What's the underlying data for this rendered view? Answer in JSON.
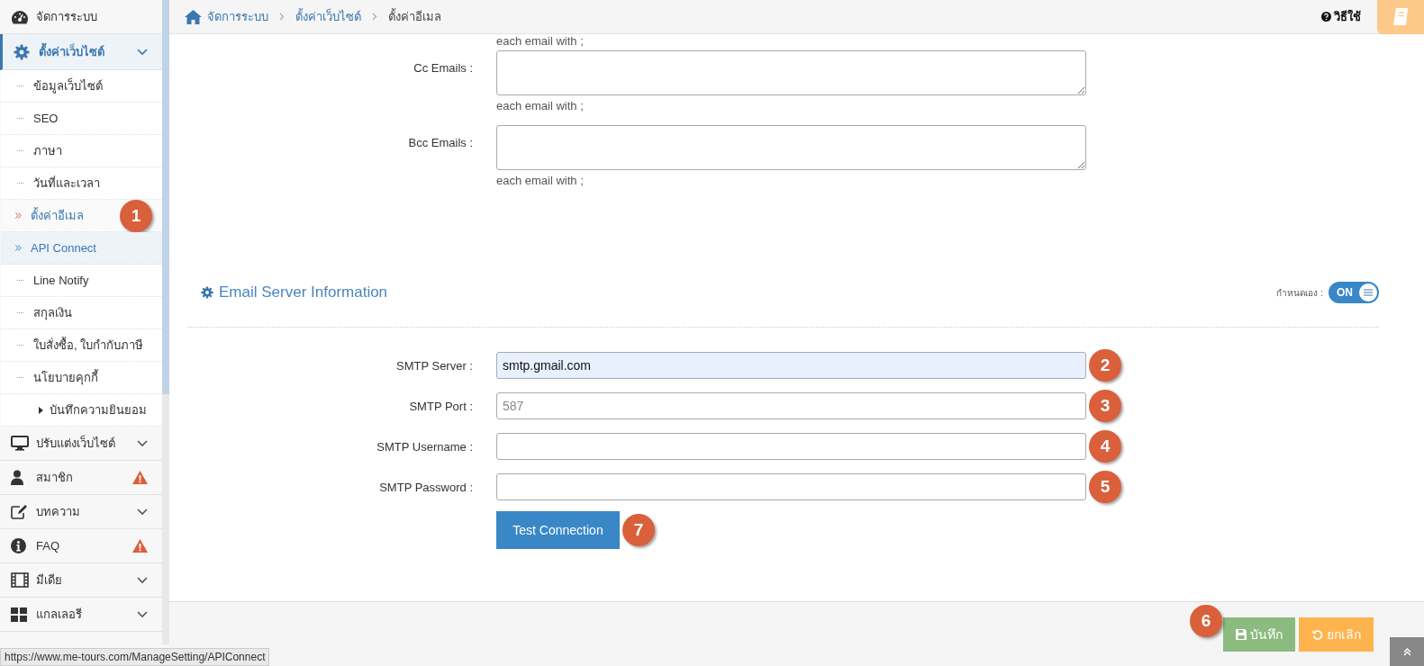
{
  "breadcrumb": [
    {
      "label": "จัดการระบบ",
      "current": false
    },
    {
      "label": "ตั้งค่าเว็บไซต์",
      "current": false
    },
    {
      "label": "ตั้งค่าอีเมล",
      "current": true
    }
  ],
  "help_link": "วิธีใช้",
  "sidebar": {
    "items": [
      {
        "label": "จัดการระบบ",
        "active": false
      },
      {
        "label": "ตั้งค่าเว็บไซต์",
        "active": true,
        "expandable": true,
        "expanded": true,
        "children": [
          {
            "label": "ข้อมูลเว็บไซต์",
            "selected": false,
            "hovered": false
          },
          {
            "label": "SEO",
            "selected": false,
            "hovered": false
          },
          {
            "label": "ภาษา",
            "selected": false,
            "hovered": false
          },
          {
            "label": "วันที่และเวลา",
            "selected": false,
            "hovered": false
          },
          {
            "label": "ตั้งค่าอีเมล",
            "selected": true,
            "hovered": false,
            "callout": "1"
          },
          {
            "label": "API Connect",
            "selected": false,
            "hovered": true
          },
          {
            "label": "Line Notify",
            "selected": false,
            "hovered": false
          },
          {
            "label": "สกุลเงิน",
            "selected": false,
            "hovered": false
          },
          {
            "label": "ใบสั่งซื้อ, ใบกำกับภาษี",
            "selected": false,
            "hovered": false
          },
          {
            "label": "นโยบายคุกกี้",
            "selected": false,
            "hovered": false,
            "children": [
              {
                "label": "บันทึกความยินยอม",
                "selected": false,
                "hovered": false
              }
            ]
          }
        ]
      },
      {
        "label": "ปรับแต่งเว็บไซต์",
        "active": false,
        "expandable": true,
        "expanded": false
      },
      {
        "label": "สมาชิก",
        "active": false,
        "warning": true
      },
      {
        "label": "บทความ",
        "active": false,
        "expandable": true,
        "expanded": false
      },
      {
        "label": "FAQ",
        "active": false,
        "warning": true
      },
      {
        "label": "มีเดีย",
        "active": false,
        "expandable": true,
        "expanded": false
      },
      {
        "label": "แกลเลอรี",
        "active": false,
        "expandable": true,
        "expanded": false
      }
    ]
  },
  "form": {
    "top_hint": "each email with ;",
    "email_fields": [
      {
        "label": "Cc Emails :",
        "hint": "each email with ;"
      },
      {
        "label": "Bcc Emails :",
        "hint": "each email with ;"
      }
    ],
    "section": {
      "title": "Email Server Information",
      "toggle": {
        "label": "กำหนดเอง :",
        "text": "ON",
        "on": true
      }
    },
    "smtp_fields": [
      {
        "label": "SMTP Server :",
        "value": "smtp.gmail.com",
        "autofilled": true,
        "callout": "2"
      },
      {
        "label": "SMTP Port :",
        "placeholder": "587",
        "autofilled": false,
        "callout": "3"
      },
      {
        "label": "SMTP Username :",
        "autofilled": false,
        "callout": "4"
      },
      {
        "label": "SMTP Password :",
        "autofilled": false,
        "callout": "5"
      }
    ],
    "test_button": {
      "label": "Test Connection",
      "callout": "7"
    }
  },
  "footer": {
    "save": {
      "label": "บันทึก",
      "callout": "6"
    },
    "cancel": {
      "label": "ยกเลิก"
    }
  },
  "status_url": "https://www.me-tours.com/ManageSetting/APIConnect"
}
